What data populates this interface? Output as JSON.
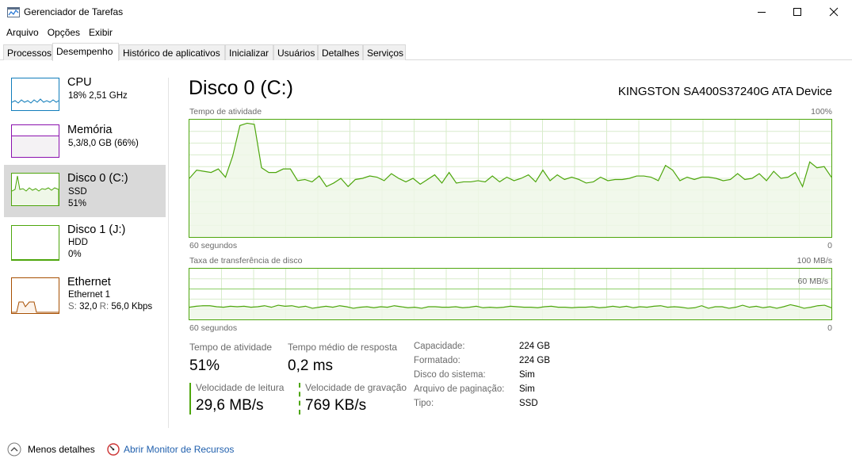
{
  "window": {
    "title": "Gerenciador de Tarefas"
  },
  "menu": [
    "Arquivo",
    "Opções",
    "Exibir"
  ],
  "tabs": [
    {
      "label": "Processos",
      "active": false
    },
    {
      "label": "Desempenho",
      "active": true
    },
    {
      "label": "Histórico de aplicativos",
      "active": false
    },
    {
      "label": "Inicializar",
      "active": false
    },
    {
      "label": "Usuários",
      "active": false
    },
    {
      "label": "Detalhes",
      "active": false
    },
    {
      "label": "Serviços",
      "active": false
    }
  ],
  "sidebar": {
    "items": [
      {
        "title": "CPU",
        "line1": "18% 2,51 GHz",
        "line2": "",
        "color": "#117dbb"
      },
      {
        "title": "Memória",
        "line1": "5,3/8,0 GB (66%)",
        "line2": "",
        "color": "#8b12ae"
      },
      {
        "title": "Disco 0 (C:)",
        "line1": "SSD",
        "line2": "51%",
        "color": "#4da60c"
      },
      {
        "title": "Disco 1 (J:)",
        "line1": "HDD",
        "line2": "0%",
        "color": "#4da60c"
      },
      {
        "title": "Ethernet",
        "line1": "Ethernet 1",
        "line2_s_label": "S:",
        "line2_s_value": "32,0",
        "line2_r_label": "R:",
        "line2_r_value": "56,0 Kbps",
        "color": "#a74f01"
      }
    ]
  },
  "main": {
    "title": "Disco 0 (C:)",
    "device": "KINGSTON SA400S37240G ATA Device",
    "chart1": {
      "label": "Tempo de atividade",
      "max_label": "100%",
      "x_left": "60 segundos",
      "x_right": "0"
    },
    "chart2": {
      "label": "Taxa de transferência de disco",
      "max_label": "100 MB/s",
      "line_label": "60 MB/s",
      "x_left": "60 segundos",
      "x_right": "0"
    },
    "stats": {
      "active_time_label": "Tempo de atividade",
      "active_time_value": "51%",
      "response_label": "Tempo médio de resposta",
      "response_value": "0,2 ms",
      "read_label": "Velocidade de leitura",
      "read_value": "29,6 MB/s",
      "write_label": "Velocidade de gravação",
      "write_value": "769 KB/s"
    },
    "properties": [
      {
        "label": "Capacidade:",
        "value": "224 GB"
      },
      {
        "label": "Formatado:",
        "value": "224 GB"
      },
      {
        "label": "Disco do sistema:",
        "value": "Sim"
      },
      {
        "label": "Arquivo de paginação:",
        "value": "Sim"
      },
      {
        "label": "Tipo:",
        "value": "SSD"
      }
    ]
  },
  "footer": {
    "less_details": "Menos detalhes",
    "resource_monitor": "Abrir Monitor de Recursos"
  },
  "chart_data": [
    {
      "type": "area",
      "title": "Tempo de atividade",
      "ylim": [
        0,
        100
      ],
      "xlabel": "60 segundos",
      "series": [
        {
          "values": [
            50,
            57,
            56,
            55,
            58,
            51,
            69,
            95,
            97,
            96,
            59,
            55,
            55,
            58,
            58,
            48,
            49,
            47,
            52,
            43,
            46,
            50,
            43,
            49,
            50,
            52,
            51,
            48,
            54,
            50,
            47,
            50,
            45,
            49,
            53,
            46,
            55,
            46,
            47,
            47,
            48,
            47,
            52,
            47,
            51,
            48,
            50,
            53,
            47,
            57,
            48,
            53,
            49,
            51,
            49,
            46,
            47,
            51,
            48,
            49,
            49,
            50,
            52,
            52,
            51,
            48,
            61,
            57,
            48,
            51,
            49,
            51,
            51,
            50,
            48,
            49,
            54,
            49,
            50,
            54,
            48,
            56,
            50,
            51,
            55,
            43,
            64,
            59,
            60,
            51
          ]
        }
      ]
    },
    {
      "type": "area",
      "title": "Taxa de transferência de disco",
      "ylim": [
        0,
        100
      ],
      "xlabel": "60 segundos",
      "series": [
        {
          "values": [
            24,
            26,
            27,
            27,
            25,
            24,
            26,
            25,
            26,
            24,
            25,
            27,
            24,
            28,
            26,
            27,
            24,
            26,
            22,
            24,
            26,
            24,
            27,
            25,
            22,
            24,
            25,
            23,
            25,
            24,
            27,
            25,
            23,
            24,
            22,
            25,
            25,
            24,
            24,
            25,
            23,
            24,
            26,
            23,
            24,
            23,
            24,
            26,
            25,
            24,
            24,
            23,
            25,
            26,
            24,
            24,
            23,
            24,
            24,
            25,
            23,
            24,
            26,
            24,
            26,
            23,
            25,
            24,
            26,
            27,
            24,
            25,
            24,
            22,
            23,
            27,
            22,
            25,
            25,
            22,
            24,
            28,
            24,
            26,
            23,
            25,
            22,
            25,
            29,
            26,
            22,
            24,
            27,
            28,
            23
          ]
        }
      ]
    }
  ]
}
